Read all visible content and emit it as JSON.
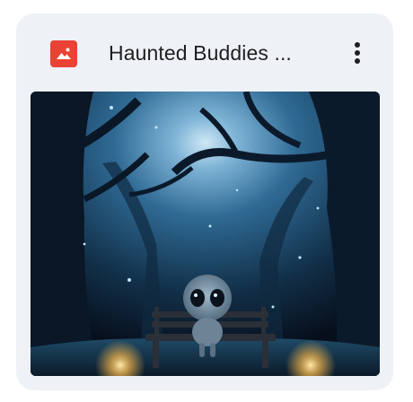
{
  "file": {
    "title": "Haunted Buddies ...",
    "icon": "image-file-icon",
    "icon_color": "#ea4335",
    "menu_icon": "more-vert-icon"
  },
  "colors": {
    "card_background": "#eef1f6",
    "title_text": "#1f1f1f"
  }
}
